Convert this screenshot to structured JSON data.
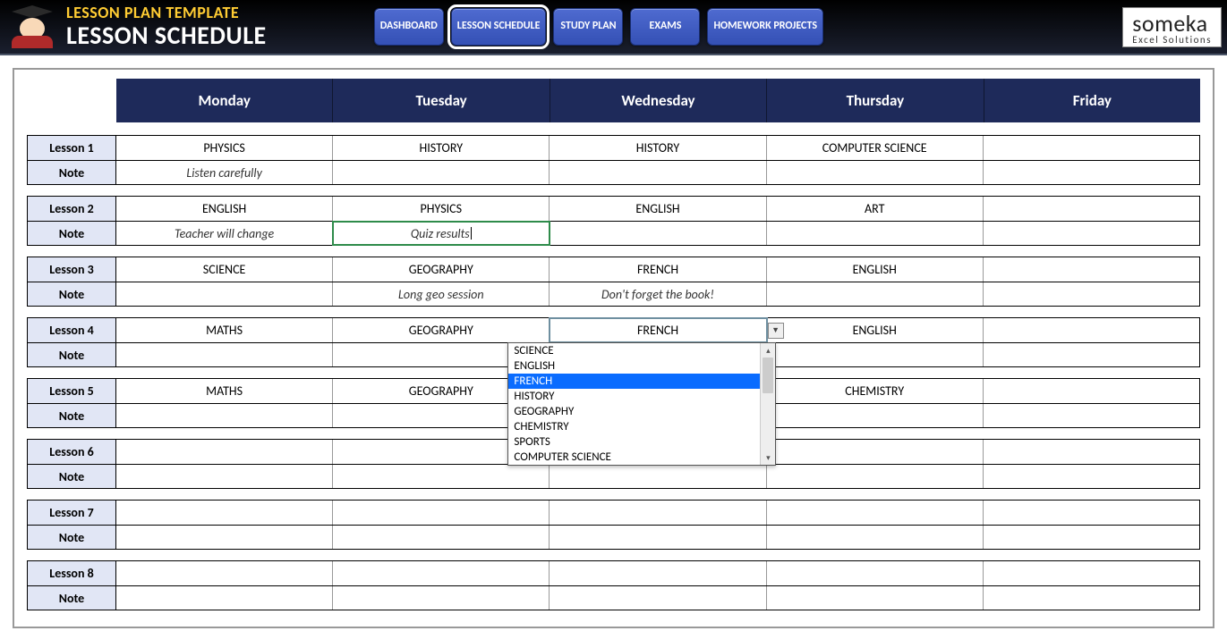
{
  "header": {
    "template_label": "LESSON PLAN TEMPLATE",
    "title": "LESSON SCHEDULE"
  },
  "nav": {
    "dashboard": "DASHBOARD",
    "lesson_schedule": "LESSON SCHEDULE",
    "study_plan": "STUDY PLAN",
    "exams": "EXAMS",
    "homework_projects": "HOMEWORK PROJECTS"
  },
  "brand": {
    "name": "someka",
    "sub": "Excel Solutions"
  },
  "days": [
    "Monday",
    "Tuesday",
    "Wednesday",
    "Thursday",
    "Friday"
  ],
  "row_labels": {
    "lesson": "Lesson",
    "note": "Note"
  },
  "lessons": [
    {
      "label": "Lesson 1",
      "subjects": [
        "PHYSICS",
        "HISTORY",
        "HISTORY",
        "COMPUTER SCIENCE",
        ""
      ],
      "notes": [
        "Listen carefully",
        "",
        "",
        "",
        ""
      ]
    },
    {
      "label": "Lesson 2",
      "subjects": [
        "ENGLISH",
        "PHYSICS",
        "ENGLISH",
        "ART",
        ""
      ],
      "notes": [
        "Teacher will change",
        "Quiz results",
        "",
        "",
        ""
      ]
    },
    {
      "label": "Lesson 3",
      "subjects": [
        "SCIENCE",
        "GEOGRAPHY",
        "FRENCH",
        "ENGLISH",
        ""
      ],
      "notes": [
        "",
        "Long geo session",
        "Don't forget the book!",
        "",
        ""
      ]
    },
    {
      "label": "Lesson 4",
      "subjects": [
        "MATHS",
        "GEOGRAPHY",
        "FRENCH",
        "ENGLISH",
        ""
      ],
      "notes": [
        "",
        "",
        "",
        "",
        ""
      ]
    },
    {
      "label": "Lesson 5",
      "subjects": [
        "MATHS",
        "GEOGRAPHY",
        "",
        "CHEMISTRY",
        ""
      ],
      "notes": [
        "",
        "",
        "",
        "",
        ""
      ]
    },
    {
      "label": "Lesson 6",
      "subjects": [
        "",
        "",
        "",
        "",
        ""
      ],
      "notes": [
        "",
        "",
        "",
        "",
        ""
      ]
    },
    {
      "label": "Lesson 7",
      "subjects": [
        "",
        "",
        "",
        "",
        ""
      ],
      "notes": [
        "",
        "",
        "",
        "",
        ""
      ]
    },
    {
      "label": "Lesson 8",
      "subjects": [
        "",
        "",
        "",
        "",
        ""
      ],
      "notes": [
        "",
        "",
        "",
        "",
        ""
      ]
    }
  ],
  "editing_cell": {
    "lesson_index": 1,
    "type": "note",
    "day_index": 1
  },
  "dropdown": {
    "lesson_index": 3,
    "day_index": 2,
    "selected": "FRENCH",
    "options": [
      "SCIENCE",
      "ENGLISH",
      "FRENCH",
      "HISTORY",
      "GEOGRAPHY",
      "CHEMISTRY",
      "SPORTS",
      "COMPUTER SCIENCE"
    ]
  }
}
